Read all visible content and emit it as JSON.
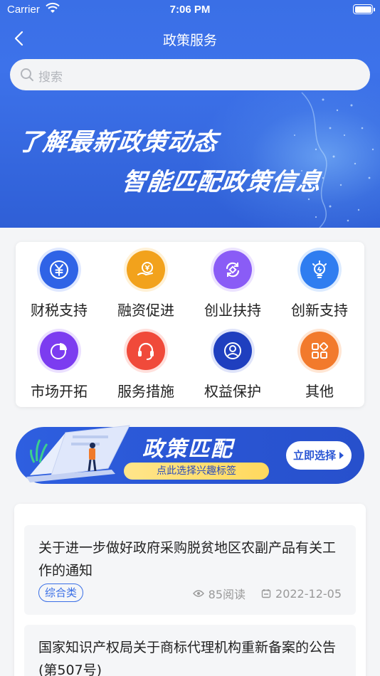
{
  "status_bar": {
    "carrier": "Carrier",
    "time": "7:06 PM"
  },
  "nav": {
    "title": "政策服务"
  },
  "search": {
    "placeholder": "搜索"
  },
  "hero": {
    "line1": "了解最新政策动态",
    "line2": "智能匹配政策信息"
  },
  "categories": [
    {
      "label": "财税支持",
      "icon": "yen-icon",
      "color": "#2f63e6"
    },
    {
      "label": "融资促进",
      "icon": "money-hand-icon",
      "color": "#f2a21c"
    },
    {
      "label": "创业扶持",
      "icon": "cycle-icon",
      "color": "#8a5cf6"
    },
    {
      "label": "创新支持",
      "icon": "lightbulb-icon",
      "color": "#2f7df0"
    },
    {
      "label": "市场开拓",
      "icon": "pie-chart-icon",
      "color": "#7c3cf0"
    },
    {
      "label": "服务措施",
      "icon": "headset-icon",
      "color": "#f04a3a"
    },
    {
      "label": "权益保护",
      "icon": "user-heart-icon",
      "color": "#1f3fbf"
    },
    {
      "label": "其他",
      "icon": "apps-icon",
      "color": "#f27a2c"
    }
  ],
  "banner": {
    "title": "政策匹配",
    "subtitle": "点此选择兴趣标签",
    "cta": "立即选择"
  },
  "news": [
    {
      "title": "关于进一步做好政府采购脱贫地区农副产品有关工作的通知",
      "tag": "综合类",
      "views": "85阅读",
      "date": "2022-12-05"
    },
    {
      "title": "国家知识产权局关于商标代理机构重新备案的公告(第507号)"
    }
  ]
}
